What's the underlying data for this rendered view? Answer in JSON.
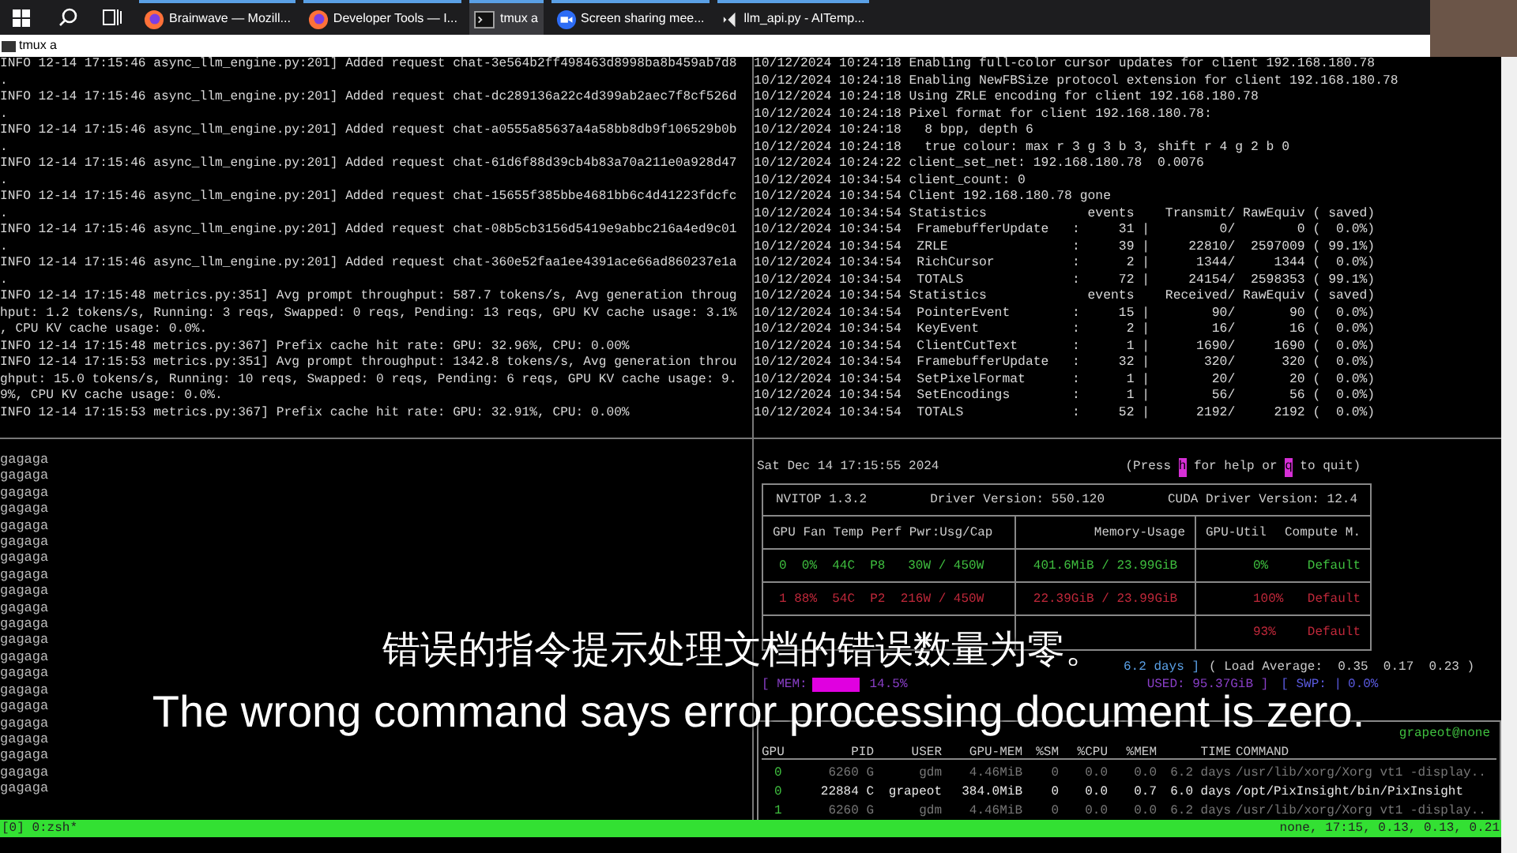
{
  "taskbar": {
    "tasks": [
      {
        "label": "Brainwave — Mozill...",
        "kind": "firefox",
        "selected": false
      },
      {
        "label": "Developer Tools — I...",
        "kind": "firefox",
        "selected": false
      },
      {
        "label": "tmux a",
        "kind": "terminal",
        "selected": true
      },
      {
        "label": "Screen sharing mee...",
        "kind": "meeting",
        "selected": false
      },
      {
        "label": "llm_api.py - AITemp...",
        "kind": "editor",
        "selected": false
      }
    ]
  },
  "window": {
    "title": "tmux a"
  },
  "server_log": {
    "lines": [
      "INFO 12-14 17:15:46 async_llm_engine.py:201] Added request chat-3e564b2ff498463d8998ba8b459ab7d8",
      ".",
      "INFO 12-14 17:15:46 async_llm_engine.py:201] Added request chat-dc289136a22c4d399ab2aec7f8cf526d",
      ".",
      "INFO 12-14 17:15:46 async_llm_engine.py:201] Added request chat-a0555a85637a4a58bb8db9f106529b0b",
      ".",
      "INFO 12-14 17:15:46 async_llm_engine.py:201] Added request chat-61d6f88d39cb4b83a70a211e0a928d47",
      ".",
      "INFO 12-14 17:15:46 async_llm_engine.py:201] Added request chat-15655f385bbe4681bb6c4d41223fdcfc",
      ".",
      "INFO 12-14 17:15:46 async_llm_engine.py:201] Added request chat-08b5cb3156d5419e9abbc216a4ed9c01",
      ".",
      "INFO 12-14 17:15:46 async_llm_engine.py:201] Added request chat-360e52faa1ee4391ace66ad860237e1a",
      ".",
      "INFO 12-14 17:15:48 metrics.py:351] Avg prompt throughput: 587.7 tokens/s, Avg generation throug",
      "hput: 1.2 tokens/s, Running: 3 reqs, Swapped: 0 reqs, Pending: 13 reqs, GPU KV cache usage: 3.1%",
      ", CPU KV cache usage: 0.0%.",
      "INFO 12-14 17:15:48 metrics.py:367] Prefix cache hit rate: GPU: 32.96%, CPU: 0.00%",
      "INFO 12-14 17:15:53 metrics.py:351] Avg prompt throughput: 1342.8 tokens/s, Avg generation throu",
      "ghput: 15.0 tokens/s, Running: 10 reqs, Swapped: 0 reqs, Pending: 6 reqs, GPU KV cache usage: 9.",
      "9%, CPU KV cache usage: 0.0%.",
      "INFO 12-14 17:15:53 metrics.py:367] Prefix cache hit rate: GPU: 32.91%, CPU: 0.00%"
    ]
  },
  "vnc_log": {
    "lines": [
      "10/12/2024 10:24:18 Enabling full-color cursor updates for client 192.168.180.78",
      "10/12/2024 10:24:18 Enabling NewFBSize protocol extension for client 192.168.180.78",
      "10/12/2024 10:24:18 Using ZRLE encoding for client 192.168.180.78",
      "10/12/2024 10:24:18 Pixel format for client 192.168.180.78:",
      "10/12/2024 10:24:18   8 bpp, depth 6",
      "10/12/2024 10:24:18   true colour: max r 3 g 3 b 3, shift r 4 g 2 b 0",
      "10/12/2024 10:24:22 client_set_net: 192.168.180.78  0.0076",
      "10/12/2024 10:34:54 client_count: 0",
      "10/12/2024 10:34:54 Client 192.168.180.78 gone",
      "10/12/2024 10:34:54 Statistics             events    Transmit/ RawEquiv ( saved)",
      "10/12/2024 10:34:54  FramebufferUpdate   :     31 |         0/        0 (  0.0%)",
      "10/12/2024 10:34:54  ZRLE                :     39 |     22810/  2597009 ( 99.1%)",
      "10/12/2024 10:34:54  RichCursor          :      2 |      1344/     1344 (  0.0%)",
      "10/12/2024 10:34:54  TOTALS              :     72 |     24154/  2598353 ( 99.1%)",
      "10/12/2024 10:34:54 Statistics             events    Received/ RawEquiv ( saved)",
      "10/12/2024 10:34:54  PointerEvent        :     15 |        90/       90 (  0.0%)",
      "10/12/2024 10:34:54  KeyEvent            :      2 |        16/       16 (  0.0%)",
      "10/12/2024 10:34:54  ClientCutText       :      1 |      1690/     1690 (  0.0%)",
      "10/12/2024 10:34:54  FramebufferUpdate   :     32 |       320/      320 (  0.0%)",
      "10/12/2024 10:34:54  SetPixelFormat      :      1 |        20/       20 (  0.0%)",
      "10/12/2024 10:34:54  SetEncodings        :      1 |        56/       56 (  0.0%)",
      "10/12/2024 10:34:54  TOTALS              :     52 |      2192/     2192 (  0.0%)"
    ]
  },
  "shell": {
    "lines": [
      "gagaga",
      "gagaga",
      "gagaga",
      "gagaga",
      "gagaga",
      "gagaga",
      "gagaga",
      "gagaga",
      "gagaga",
      "gagaga",
      "gagaga",
      "gagaga",
      "gagaga",
      "gagaga",
      "gagaga",
      "gagaga",
      "gagaga",
      "gagaga",
      "gagaga",
      "gagaga",
      "gagaga"
    ]
  },
  "nvitop": {
    "datetime": "Sat Dec 14 17:15:55 2024",
    "help": [
      {
        "text": "(Press ",
        "kind": "text"
      },
      {
        "text": "h",
        "kind": "key"
      },
      {
        "text": " for help or ",
        "kind": "text"
      },
      {
        "text": "q",
        "kind": "key"
      },
      {
        "text": " to quit)",
        "kind": "text"
      }
    ],
    "version": "NVITOP 1.3.2",
    "driver": "Driver Version: 550.120",
    "cuda": "CUDA Driver Version: 12.4",
    "columns": [
      "GPU Fan Temp Perf Pwr:Usg/Cap",
      "Memory-Usage",
      "GPU-Util",
      "Compute M."
    ],
    "gpus": [
      {
        "info": "0  0%  44C  P8   30W / 450W",
        "memory": "401.6MiB / 23.99GiB",
        "util": "0%",
        "mode": "Default",
        "color": "#3fbf3f"
      },
      {
        "info": "1 88%  54C  P2  216W / 450W",
        "memory": "22.39GiB / 23.99GiB",
        "util": "100%",
        "mode": "Default",
        "color": "#c0283a"
      },
      {
        "util": "93%",
        "mode": "Default",
        "color": "#c0283a"
      }
    ],
    "uptime": "6.2 days ]",
    "load": "( Load Average:  0.35  0.17  0.23 )",
    "mem": {
      "label": "[ MEM:",
      "level": 0.145,
      "percent": "14.5%",
      "used": "USED: 95.37GiB ]"
    },
    "swap": {
      "label": "[ SWP: |",
      "percent": "0.0%"
    },
    "processes": {
      "user": "grapeot@none",
      "columns": [
        "GPU",
        "PID",
        "USER",
        "GPU-MEM",
        "%SM",
        "%CPU",
        "%MEM",
        "TIME",
        "COMMAND"
      ],
      "rows": [
        {
          "cells": [
            "0",
            "6260 G",
            "gdm",
            "4.46MiB",
            "0",
            "0.0",
            "0.0",
            "6.2 days",
            "/usr/lib/xorg/Xorg vt1 -display.."
          ],
          "highlight": false
        },
        {
          "cells": [
            "0",
            "22884 C",
            "grapeot",
            "384.0MiB",
            "0",
            "0.0",
            "0.7",
            "6.0 days",
            "/opt/PixInsight/bin/PixInsight"
          ],
          "highlight": true
        },
        {
          "cells": [
            "1",
            "6260 G",
            "gdm",
            "4.46MiB",
            "0",
            "0.0",
            "0.0",
            "6.2 days",
            "/usr/lib/xorg/Xorg vt1 -display.."
          ],
          "highlight": false
        }
      ]
    }
  },
  "status_bar": {
    "left": "[0] 0:zsh*",
    "right": "none, 17:15, 0.13, 0.13, 0.21"
  },
  "subtitles": [
    "错误的指令提示处理文档的错误数量为零。",
    "The wrong command says error processing document is zero."
  ]
}
